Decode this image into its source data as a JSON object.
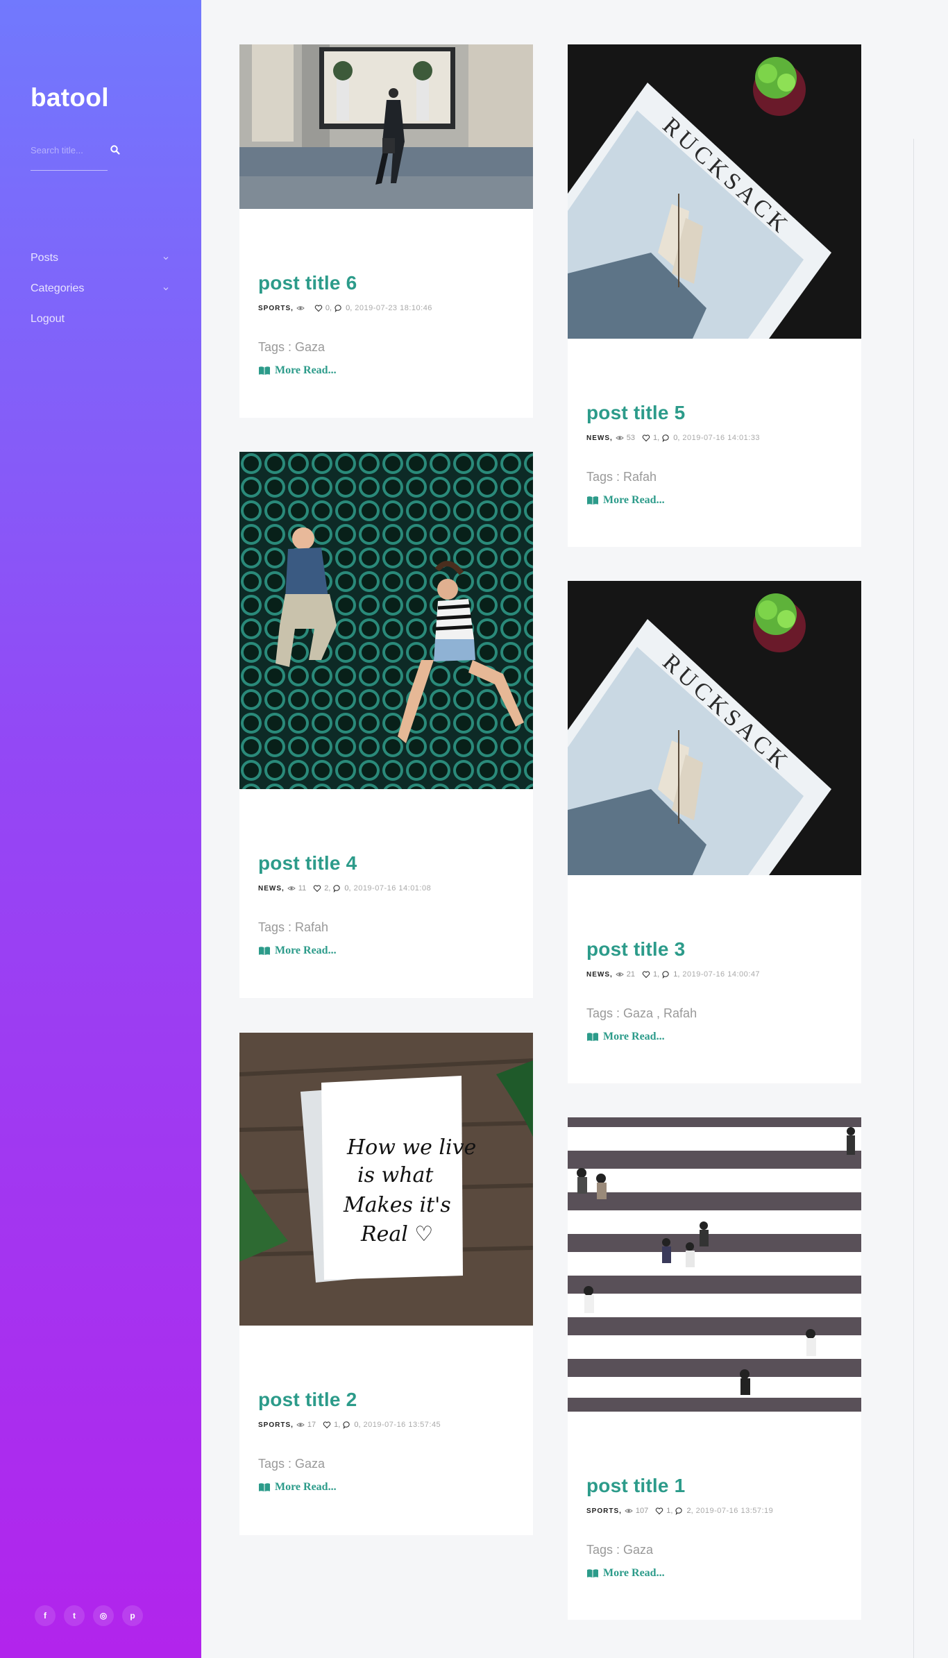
{
  "sidebar": {
    "brand": "batool",
    "search_placeholder": "Search title...",
    "nav": [
      {
        "label": "Posts",
        "has_submenu": true
      },
      {
        "label": "Categories",
        "has_submenu": true
      },
      {
        "label": "Logout",
        "has_submenu": false
      }
    ],
    "socials": [
      {
        "icon": "facebook-icon",
        "glyph": "f"
      },
      {
        "icon": "twitter-icon",
        "glyph": "t"
      },
      {
        "icon": "dribbble-icon",
        "glyph": "◎"
      },
      {
        "icon": "pinterest-icon",
        "glyph": "p"
      }
    ]
  },
  "colors": {
    "accent": "#2c9b8a",
    "sidebar_top": "#7179fd",
    "sidebar_bottom": "#b224ec"
  },
  "posts": [
    {
      "id": 6,
      "title": "post title 6",
      "category": "SPORTS,",
      "views": "",
      "likes": "0,",
      "comments": "0,",
      "date": "2019-07-23 18:10:46",
      "tags": "Tags : Gaza",
      "more": "More Read...",
      "image": "street-walker-photo"
    },
    {
      "id": 5,
      "title": "post title 5",
      "category": "NEWS,",
      "views": "53",
      "likes": "1,",
      "comments": "0,",
      "date": "2019-07-16 14:01:33",
      "tags": "Tags : Rafah",
      "more": "More Read...",
      "image": "rucksack-magazine-photo"
    },
    {
      "id": 4,
      "title": "post title 4",
      "category": "NEWS,",
      "views": "11",
      "likes": "2,",
      "comments": "0,",
      "date": "2019-07-16 14:01:08",
      "tags": "Tags : Rafah",
      "more": "More Read...",
      "image": "jumping-couple-photo"
    },
    {
      "id": 3,
      "title": "post title 3",
      "category": "NEWS,",
      "views": "21",
      "likes": "1,",
      "comments": "1,",
      "date": "2019-07-16 14:00:47",
      "tags": "Tags : Gaza , Rafah",
      "more": "More Read...",
      "image": "rucksack-magazine-photo"
    },
    {
      "id": 2,
      "title": "post title 2",
      "category": "SPORTS,",
      "views": "17",
      "likes": "1,",
      "comments": "0,",
      "date": "2019-07-16 13:57:45",
      "tags": "Tags : Gaza",
      "more": "More Read...",
      "image": "how-we-live-card-photo"
    },
    {
      "id": 1,
      "title": "post title 1",
      "category": "SPORTS,",
      "views": "107",
      "likes": "1,",
      "comments": "2,",
      "date": "2019-07-16 13:57:19",
      "tags": "Tags : Gaza",
      "more": "More Read...",
      "image": "crosswalk-photo"
    }
  ],
  "image_text": {
    "rucksack": "RUCKSACK",
    "card_line1": "How we live",
    "card_line2": "is what",
    "card_line3": "Makes it's",
    "card_line4": "Real ♡"
  }
}
